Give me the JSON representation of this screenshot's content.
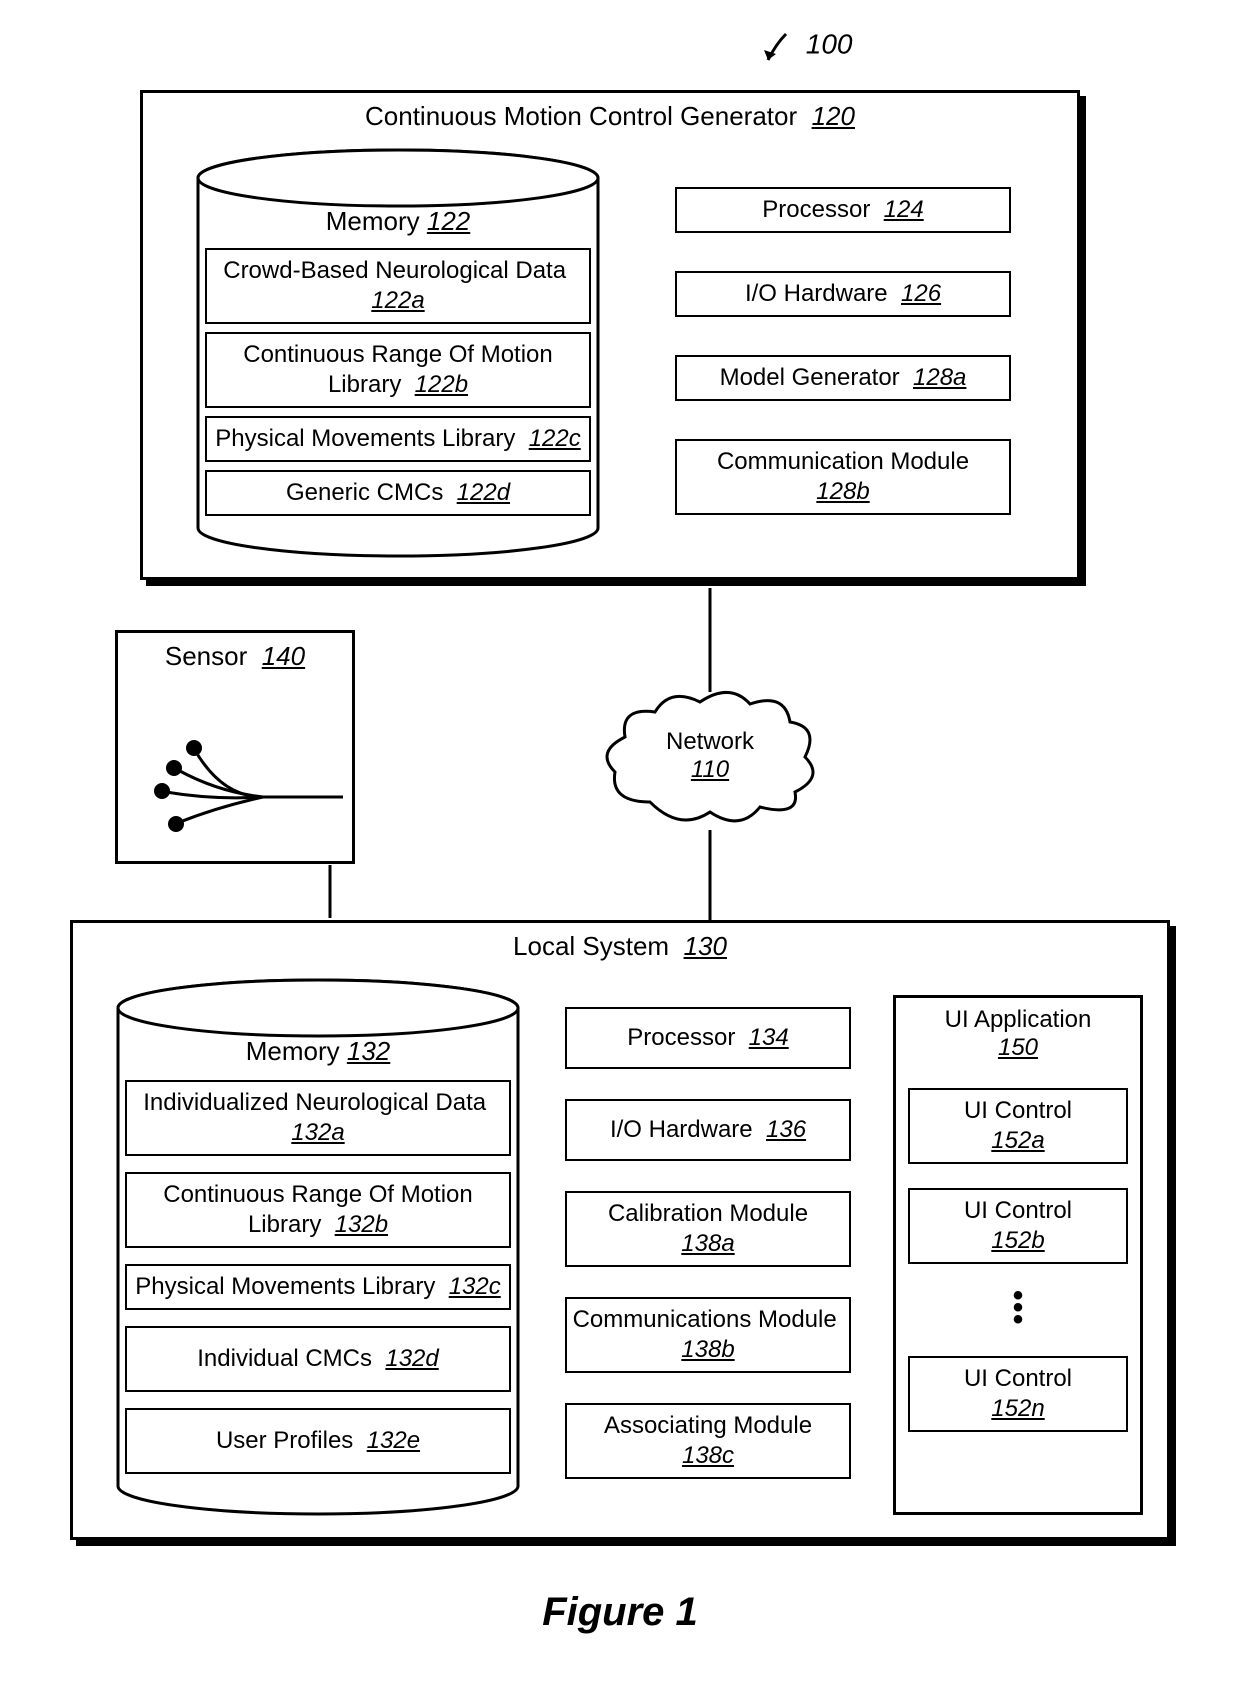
{
  "page_ref": "100",
  "figure_caption": "Figure 1",
  "generator": {
    "title_text": "Continuous Motion Control Generator",
    "title_ref": "120",
    "memory": {
      "title_text": "Memory",
      "title_ref": "122",
      "items": [
        {
          "text": "Crowd-Based Neurological Data",
          "ref": "122a"
        },
        {
          "text": "Continuous Range Of Motion Library",
          "ref": "122b"
        },
        {
          "text": "Physical Movements Library",
          "ref": "122c"
        },
        {
          "text": "Generic CMCs",
          "ref": "122d"
        }
      ]
    },
    "right": [
      {
        "text": "Processor",
        "ref": "124"
      },
      {
        "text": "I/O Hardware",
        "ref": "126"
      },
      {
        "text": "Model Generator",
        "ref": "128a"
      },
      {
        "text": "Communication Module",
        "ref": "128b"
      }
    ]
  },
  "sensor": {
    "title_text": "Sensor",
    "title_ref": "140"
  },
  "network": {
    "title_text": "Network",
    "title_ref": "110"
  },
  "local": {
    "title_text": "Local System",
    "title_ref": "130",
    "memory": {
      "title_text": "Memory",
      "title_ref": "132",
      "items": [
        {
          "text": "Individualized Neurological Data",
          "ref": "132a"
        },
        {
          "text": "Continuous Range Of Motion Library",
          "ref": "132b"
        },
        {
          "text": "Physical Movements Library",
          "ref": "132c"
        },
        {
          "text": "Individual CMCs",
          "ref": "132d"
        },
        {
          "text": "User Profiles",
          "ref": "132e"
        }
      ]
    },
    "middle": [
      {
        "text": "Processor",
        "ref": "134"
      },
      {
        "text": "I/O Hardware",
        "ref": "136"
      },
      {
        "text": "Calibration Module",
        "ref": "138a"
      },
      {
        "text": "Communications Module",
        "ref": "138b"
      },
      {
        "text": "Associating Module",
        "ref": "138c"
      }
    ],
    "ui": {
      "title_text": "UI Application",
      "title_ref": "150",
      "controls": [
        {
          "text": "UI Control",
          "ref": "152a"
        },
        {
          "text": "UI Control",
          "ref": "152b"
        },
        {
          "text": "UI Control",
          "ref": "152n"
        }
      ]
    }
  }
}
